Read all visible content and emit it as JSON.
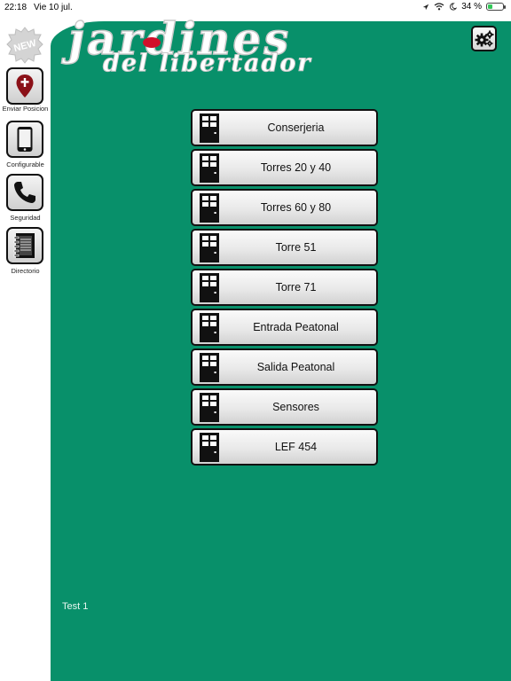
{
  "status_bar": {
    "time": "22:18",
    "date": "Vie 10 jul.",
    "battery_text": "34 %",
    "battery_level": 0.34,
    "icons": [
      "location-icon",
      "wifi-icon",
      "moon-icon",
      "battery-icon"
    ]
  },
  "sidebar": {
    "new_badge": "NEW",
    "items": [
      {
        "label": "Enviar Posicion",
        "icon": "map-pin-icon"
      },
      {
        "label": "Configurable",
        "icon": "phone-device-icon"
      },
      {
        "label": "Seguridad",
        "icon": "phone-handset-icon"
      },
      {
        "label": "Directorio",
        "icon": "notebook-icon"
      }
    ]
  },
  "header": {
    "logo_title": "jardines",
    "logo_subtitle": "del libertador",
    "settings_icon": "gears-icon"
  },
  "doors": [
    {
      "label": "Conserjeria"
    },
    {
      "label": "Torres 20 y 40"
    },
    {
      "label": "Torres 60 y 80"
    },
    {
      "label": "Torre 51"
    },
    {
      "label": "Torre 71"
    },
    {
      "label": "Entrada Peatonal"
    },
    {
      "label": "Salida Peatonal"
    },
    {
      "label": "Sensores"
    },
    {
      "label": "LEF 454"
    }
  ],
  "footer": {
    "text": "Test 1"
  },
  "colors": {
    "main_background": "#08906a",
    "logo_dot": "#d0102a",
    "pin": "#8b1118"
  }
}
